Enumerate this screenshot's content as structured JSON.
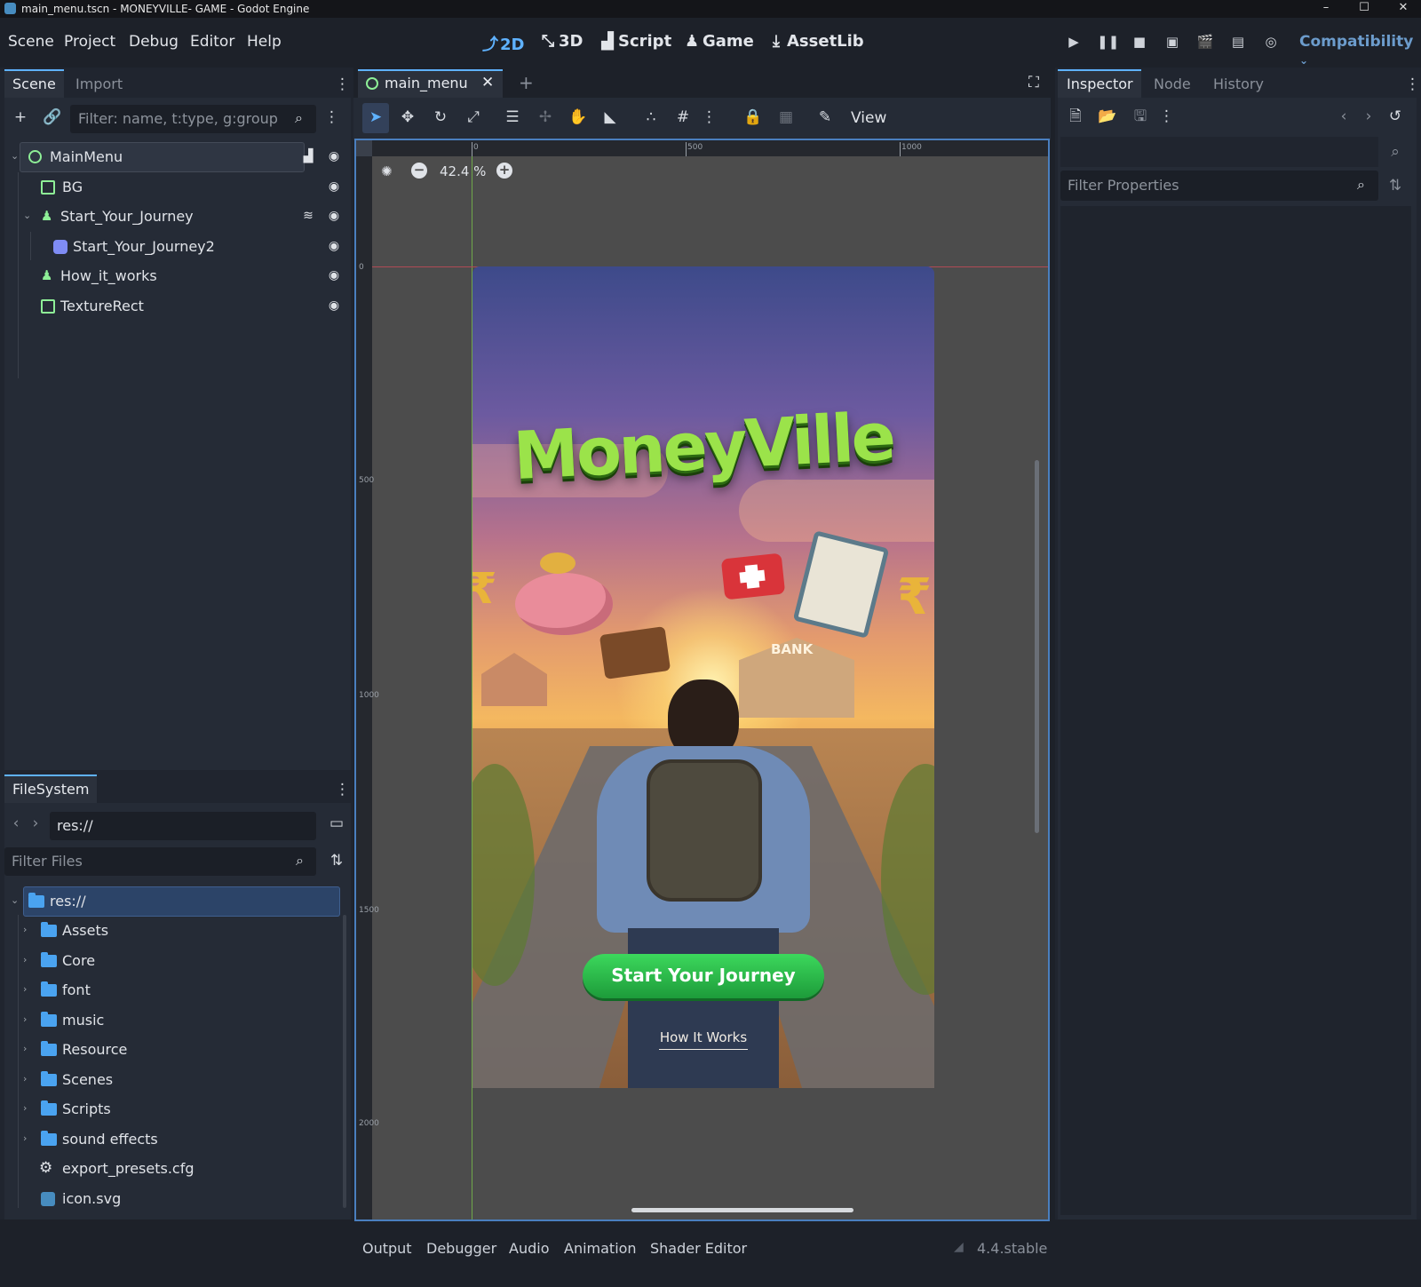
{
  "window": {
    "title": "main_menu.tscn - MONEYVILLE- GAME - Godot Engine",
    "minimize": "–",
    "maximize": "☐",
    "close": "✕"
  },
  "menu": [
    "Scene",
    "Project",
    "Debug",
    "Editor",
    "Help"
  ],
  "main_screens": [
    {
      "label": "2D",
      "icon": "2d-icon"
    },
    {
      "label": "3D",
      "icon": "3d-icon"
    },
    {
      "label": "Script",
      "icon": "script-icon"
    },
    {
      "label": "Game",
      "icon": "game-icon"
    },
    {
      "label": "AssetLib",
      "icon": "assetlib-icon"
    }
  ],
  "renderer": "Compatibility",
  "scene_dock": {
    "tabs": [
      "Scene",
      "Import"
    ],
    "filter_placeholder": "Filter: name, t:type, g:group",
    "nodes": [
      {
        "name": "MainMenu",
        "type": "Control",
        "depth": 0
      },
      {
        "name": "BG",
        "type": "TextureRect",
        "depth": 1
      },
      {
        "name": "Start_Your_Journey",
        "type": "Button",
        "depth": 1
      },
      {
        "name": "Start_Your_Journey2",
        "type": "Sprite",
        "depth": 2
      },
      {
        "name": "How_it_works",
        "type": "Button",
        "depth": 1
      },
      {
        "name": "TextureRect",
        "type": "TextureRect",
        "depth": 1
      }
    ]
  },
  "filesystem": {
    "tab": "FileSystem",
    "path": "res://",
    "filter_placeholder": "Filter Files",
    "items": [
      {
        "name": "res://",
        "kind": "folder",
        "depth": 0
      },
      {
        "name": "Assets",
        "kind": "folder",
        "depth": 1
      },
      {
        "name": "Core",
        "kind": "folder",
        "depth": 1
      },
      {
        "name": "font",
        "kind": "folder",
        "depth": 1
      },
      {
        "name": "music",
        "kind": "folder",
        "depth": 1
      },
      {
        "name": "Resource",
        "kind": "folder",
        "depth": 1
      },
      {
        "name": "Scenes",
        "kind": "folder",
        "depth": 1
      },
      {
        "name": "Scripts",
        "kind": "folder",
        "depth": 1
      },
      {
        "name": "sound effects",
        "kind": "folder",
        "depth": 1
      },
      {
        "name": "export_presets.cfg",
        "kind": "config",
        "depth": 1
      },
      {
        "name": "icon.svg",
        "kind": "svg",
        "depth": 1
      }
    ]
  },
  "viewport": {
    "tab_label": "main_menu",
    "view_label": "View",
    "zoom": "42.4 %",
    "ruler_h": [
      "0",
      "500",
      "1000"
    ],
    "ruler_v": [
      "0",
      "500",
      "1000",
      "1500",
      "2000"
    ],
    "game_logo": "MoneyVille",
    "bank_sign": "BANK",
    "start_button": "Start Your Journey",
    "how_link": "How It Works"
  },
  "bottom_panel": {
    "tabs": [
      "Output",
      "Debugger",
      "Audio",
      "Animation",
      "Shader Editor"
    ],
    "version": "4.4.stable"
  },
  "inspector": {
    "tabs": [
      "Inspector",
      "Node",
      "History"
    ],
    "filter_placeholder": "Filter Properties"
  },
  "colors": {
    "accent": "#5fb2ff",
    "node_green": "#8eef97",
    "folder": "#4aa3f0",
    "button_green": "#2fb84a"
  }
}
